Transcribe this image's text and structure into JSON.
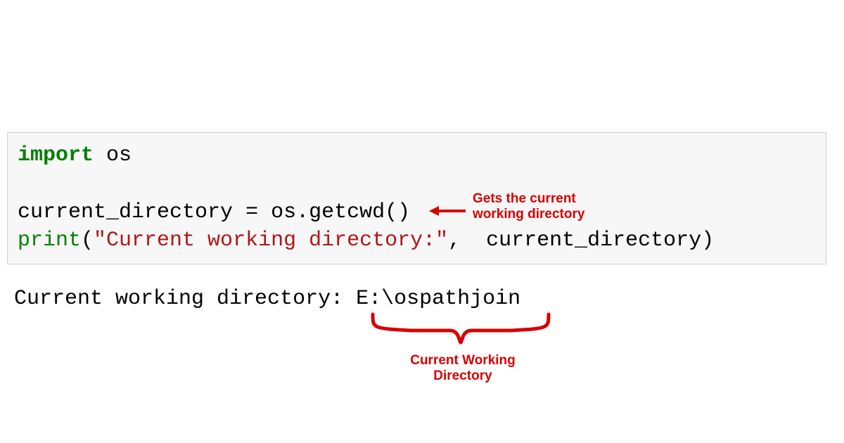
{
  "code": {
    "line1": {
      "keyword": "import",
      "module": " os"
    },
    "line2": {
      "var": "current_directory ",
      "eq": "= ",
      "obj": "os",
      "dot": ".",
      "fn": "getcwd",
      "paren": "()"
    },
    "line3": {
      "fn": "print",
      "open": "(",
      "str": "\"Current working directory:\"",
      "comma": ",  ",
      "arg": "current_directory",
      "close": ")"
    }
  },
  "output": {
    "text": "Current working directory: E:\\ospathjoin"
  },
  "annotations": {
    "arrow_note": "Gets the current\nworking directory",
    "brace_note": "Current Working\nDirectory"
  },
  "colors": {
    "keyword": "#008000",
    "string": "#b31515",
    "annotation": "#d90000"
  }
}
